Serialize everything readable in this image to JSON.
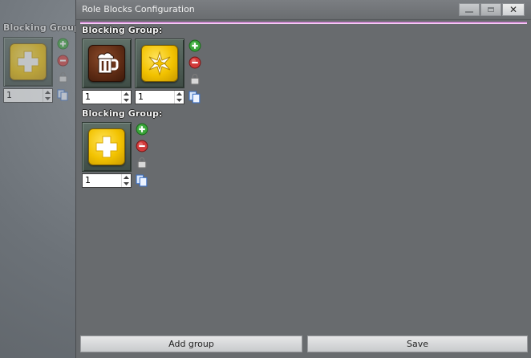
{
  "window": {
    "title": "Role Blocks Configuration",
    "minimize_icon": "minimize-icon",
    "maximize_icon": "maximize-icon",
    "close_glyph": "✕",
    "progress_color": "#e9a7ea"
  },
  "background_group": {
    "label": "Blocking Group:",
    "icon": "medical-cross-icon",
    "count": "1"
  },
  "groups": [
    {
      "label": "Blocking Group:",
      "items": [
        {
          "icon": "beer-mug-icon",
          "count": "1"
        },
        {
          "icon": "sunburst-star-icon",
          "count": "1"
        }
      ],
      "actions": [
        "add-icon",
        "remove-icon",
        "lock-icon",
        "copy-icon"
      ]
    },
    {
      "label": "Blocking Group:",
      "items": [
        {
          "icon": "medical-cross-icon",
          "count": "1"
        }
      ],
      "actions": [
        "add-icon",
        "remove-icon",
        "lock-icon",
        "copy-icon"
      ]
    }
  ],
  "buttons": {
    "add_group": "Add group",
    "save": "Save"
  },
  "colors": {
    "window_bg": "#686b6e",
    "tile_yellow": "#f2c200",
    "tile_brown": "#5d2b14",
    "add_green": "#3aa63a",
    "remove_red": "#d23a3a"
  }
}
